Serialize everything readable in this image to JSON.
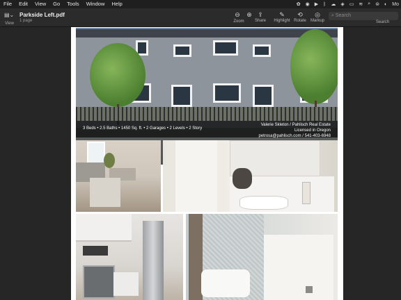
{
  "menubar": {
    "items": [
      "File",
      "Edit",
      "View",
      "Go",
      "Tools",
      "Window",
      "Help"
    ],
    "status_text": "Mo"
  },
  "toolbar": {
    "view_label": "View",
    "document_title": "Parkside Left.pdf",
    "page_count": "1 page",
    "tools": [
      {
        "label": "Zoom",
        "icon": "zoom-out-icon"
      },
      {
        "label": "Share",
        "icon": "share-icon"
      },
      {
        "label": "Highlight",
        "icon": "highlight-icon"
      },
      {
        "label": "Rotate",
        "icon": "rotate-icon"
      },
      {
        "label": "Markup",
        "icon": "markup-icon"
      }
    ],
    "search_placeholder": "Search",
    "search_label": "Search"
  },
  "flyer": {
    "specs": "3 Beds  •  2.5 Baths  •  1450 Sq. ft.  •  2 Garages  •  2 Levels  •  2 Story",
    "agent_line1": "Valerie Skleton / Pahlisch Real Estate",
    "agent_line2": "Licensed in Oregon",
    "agent_line3": "petrosa@pahlisch.com / 541-403-6948"
  }
}
